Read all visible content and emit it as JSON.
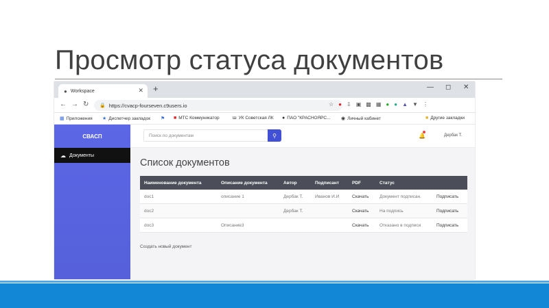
{
  "slide": {
    "title": "Просмотр статуса документов"
  },
  "browser": {
    "tab_title": "Workspace",
    "url": "https://cvacp-fourseven.c9users.io",
    "bookmarks": [
      "Приложения",
      "Диспетчер закладок",
      "МТС Коммуникатор",
      "УК Советская ЛК",
      "ПАО \"КРАСНОЯРС...",
      "Личный кабинет",
      "Другие закладки"
    ]
  },
  "app": {
    "brand": "СВАСП",
    "sidebar_item": "Документы",
    "search_placeholder": "Поиск по документам",
    "user": "Дербак Т.",
    "heading": "Список документов",
    "columns": [
      "Наименование документа",
      "Описание документа",
      "Автор",
      "Подписант",
      "PDF",
      "Статус",
      ""
    ],
    "rows": [
      [
        "doc1",
        "описание 1",
        "Дербак Т.",
        "Иванов И.И",
        "Скачать",
        "Документ подписан.",
        "Подписать"
      ],
      [
        "doc2",
        "",
        "Дербак Т.",
        "",
        "Скачать",
        "На подпись",
        "Подписать"
      ],
      [
        "doc3",
        "Описание3",
        "",
        "",
        "Скачать",
        "Отказано в подписи",
        "Подписать"
      ]
    ],
    "create_link": "Создать новый документ"
  },
  "colors": {
    "sidebar": "#5c67e6",
    "header_row": "#4b4e58",
    "search_button": "#4250d6",
    "footer_band": "#1287d6"
  }
}
